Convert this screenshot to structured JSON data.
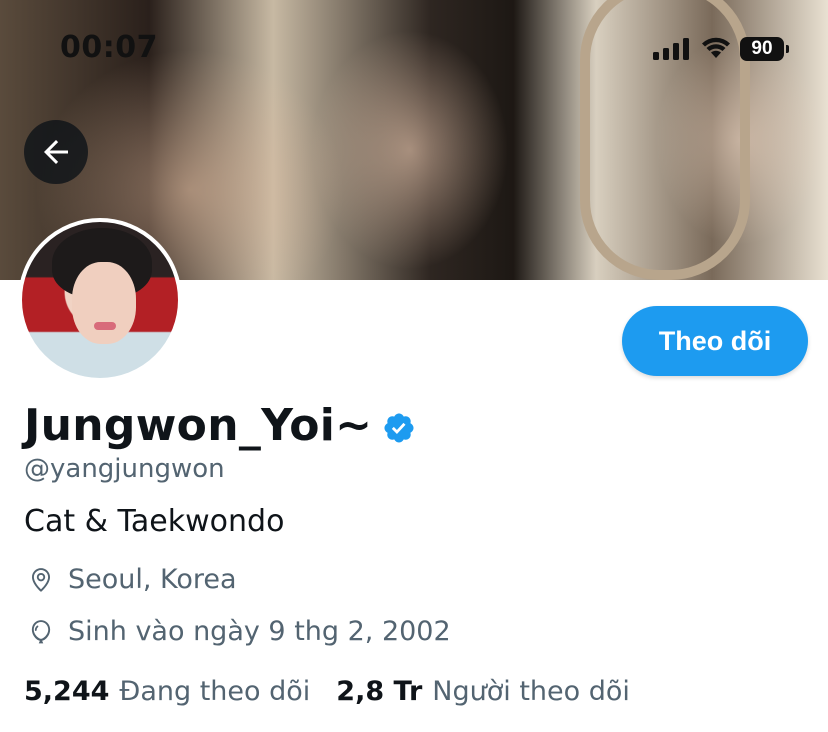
{
  "status_bar": {
    "time": "00:07",
    "battery": "90"
  },
  "header": {
    "back_icon": "arrow-left-icon"
  },
  "profile": {
    "display_name": "Jungwon_Yoi~",
    "verified_icon": "verified-badge-icon",
    "handle": "@yangjungwon",
    "bio": "Cat & Taekwondo",
    "location": "Seoul, Korea",
    "location_icon": "location-pin-icon",
    "birthday": "Sinh vào ngày 9 thg 2, 2002",
    "birthday_icon": "balloon-icon",
    "following_count": "5,244",
    "following_label": "Đang theo dõi",
    "followers_count": "2,8 Tr",
    "followers_label": "Người theo dõi"
  },
  "actions": {
    "follow_label": "Theo dõi"
  },
  "colors": {
    "accent": "#1d9bf0",
    "text_primary": "#0f1419",
    "text_secondary": "#536471"
  }
}
